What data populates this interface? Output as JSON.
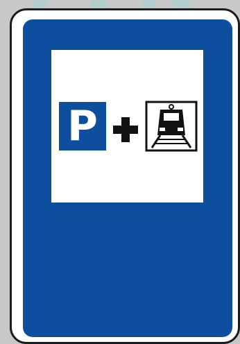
{
  "sign": {
    "type": "park-and-ride",
    "parking_letter": "P",
    "combinator_icon": "plus-icon",
    "transport_icon": "train-icon"
  },
  "colors": {
    "sign_blue": "#0e4e9f",
    "panel_white": "#ffffff",
    "border_black": "#1c1c1c",
    "symbol_black": "#111111",
    "background_gray": "#c8c8ca",
    "watermark_tint": "#8ad8d8"
  }
}
